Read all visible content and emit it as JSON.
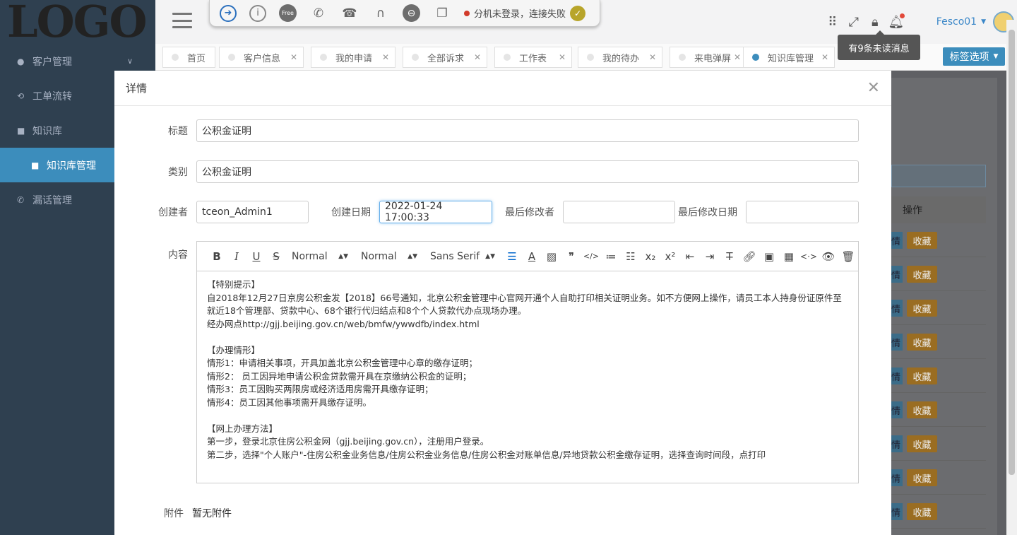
{
  "sidebar": {
    "logo": "LOGO",
    "items": [
      {
        "label": "客户管理",
        "has_children": true
      },
      {
        "label": "工单流转"
      },
      {
        "label": "知识库"
      },
      {
        "label": "知识库管理",
        "active": true
      },
      {
        "label": "漏话管理"
      }
    ]
  },
  "phonebar": {
    "free_label": "Free",
    "status_text": "分机未登录，连接失败"
  },
  "header": {
    "user_name": "Fesco01",
    "notification_tooltip": "有9条未读消息"
  },
  "tabs": [
    {
      "label": "首页",
      "closable": false
    },
    {
      "label": "客户信息",
      "closable": true
    },
    {
      "label": "我的申请",
      "closable": true
    },
    {
      "label": "全部诉求",
      "closable": true
    },
    {
      "label": "工作表",
      "closable": true
    },
    {
      "label": "我的待办",
      "closable": true
    },
    {
      "label": "来电弹屏",
      "closable": true
    },
    {
      "label": "知识库管理",
      "closable": true,
      "active": true
    }
  ],
  "tag_options_label": "标签选项",
  "background_table": {
    "header": "操作",
    "btn_view": "情",
    "btn_collect": "收藏",
    "row_count": 9
  },
  "modal": {
    "title": "详情",
    "fields": {
      "title_label": "标题",
      "title_value": "公积金证明",
      "category_label": "类别",
      "category_value": "公积金证明",
      "creator_label": "创建者",
      "creator_value": "tceon_Admin1",
      "create_date_label": "创建日期",
      "create_date_value": "2022-01-24 17:00:33",
      "modifier_label": "最后修改者",
      "modifier_value": "",
      "modify_date_label": "最后修改日期",
      "modify_date_value": "",
      "content_label": "内容",
      "attachment_label": "附件",
      "attachment_value": "暂无附件"
    },
    "editor": {
      "header_select": "Normal",
      "size_select": "Normal",
      "font_select": "Sans Serif",
      "lines": [
        "【特别提示】",
        "自2018年12月27日京房公积金发【2018】66号通知，北京公积金管理中心官网开通个人自助打印相关证明业务。如不方便网上操作，请员工本人持身份证原件至就近18个管理部、贷款中心、68个银行代归结点和8个个人贷款代办点现场办理。",
        "经办网点http://gjj.beijing.gov.cn/web/bmfw/ywwdfb/index.html",
        "",
        "【办理情形】",
        "情形1：申请相关事项，开具加盖北京公积金管理中心章的缴存证明；",
        "情形2： 员工因异地申请公积金贷款需开具在京缴纳公积金的证明；",
        "情形3：员工因购买两限房或经济适用房需开具缴存证明；",
        "情形4：员工因其他事项需开具缴存证明。",
        "",
        "【网上办理方法】",
        "第一步，登录北京住房公积金网（gjj.beijing.gov.cn），注册用户登录。",
        "第二步，选择\"个人账户\"-住房公积金业务信息/住房公积金业务信息/住房公积金对账单信息/异地贷款公积金缴存证明，选择查询时间段，点打印"
      ]
    }
  }
}
